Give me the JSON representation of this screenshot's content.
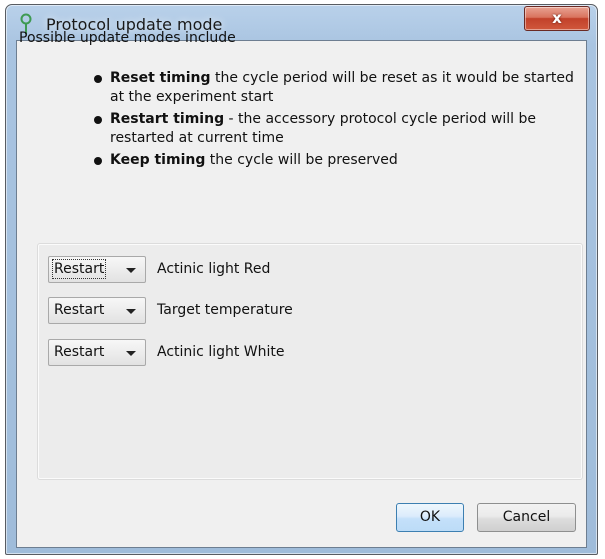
{
  "window": {
    "title": "Protocol update mode",
    "icon": "pin-icon",
    "close_label": "x"
  },
  "intro": "Possible update modes include",
  "modes": [
    {
      "name": "Reset timing",
      "desc": " the cycle period will be reset as it would be started at the experiment start"
    },
    {
      "name": "Restart timing",
      "desc": " - the accessory protocol cycle period will be restarted at current time"
    },
    {
      "name": "Keep timing",
      "desc": " the cycle will be preserved"
    }
  ],
  "parameters": [
    {
      "mode": "Restart",
      "label": "Actinic light Red"
    },
    {
      "mode": "Restart",
      "label": "Target temperature"
    },
    {
      "mode": "Restart",
      "label": "Actinic light White"
    }
  ],
  "buttons": {
    "ok": "OK",
    "cancel": "Cancel"
  },
  "colors": {
    "accent": "#3c7fb1",
    "close": "#c2412a",
    "frame": "#a9c4e1"
  }
}
